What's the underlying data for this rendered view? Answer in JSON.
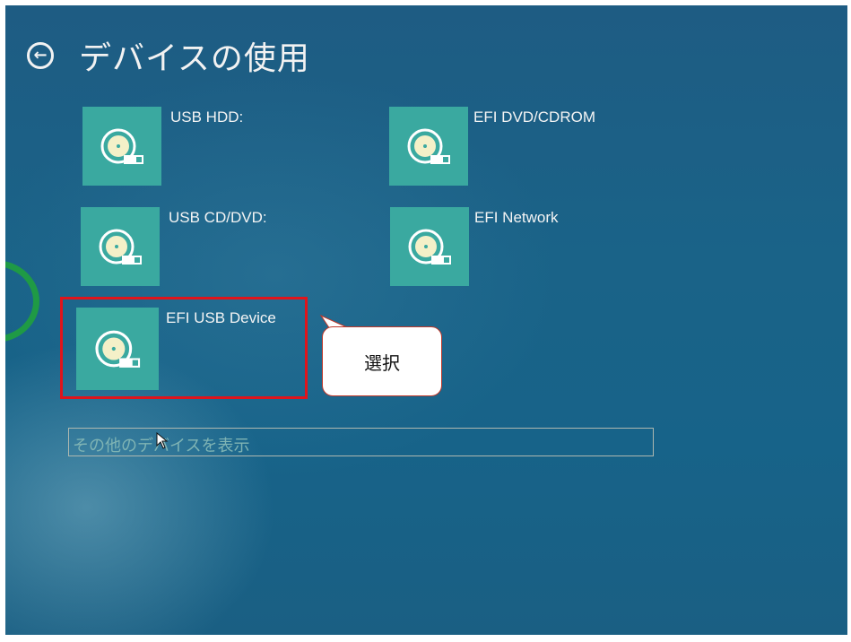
{
  "header": {
    "back_icon": "back-arrow-icon",
    "title": "デバイスの使用"
  },
  "devices": [
    {
      "label": "USB HDD:",
      "icon": "disk-drive-icon"
    },
    {
      "label": "EFI DVD/CDROM",
      "icon": "disk-drive-icon"
    },
    {
      "label": "USB CD/DVD:",
      "icon": "disk-drive-icon"
    },
    {
      "label": "EFI Network",
      "icon": "disk-drive-icon"
    },
    {
      "label": "EFI USB Device",
      "icon": "disk-drive-icon"
    }
  ],
  "more_devices": {
    "label": "その他のデバイスを表示"
  },
  "annotation": {
    "callout_text": "選択",
    "highlight_color": "#e0141b"
  },
  "colors": {
    "background": "#1a6388",
    "tile": "#3aa9a0",
    "text": "#f4f4f4"
  }
}
